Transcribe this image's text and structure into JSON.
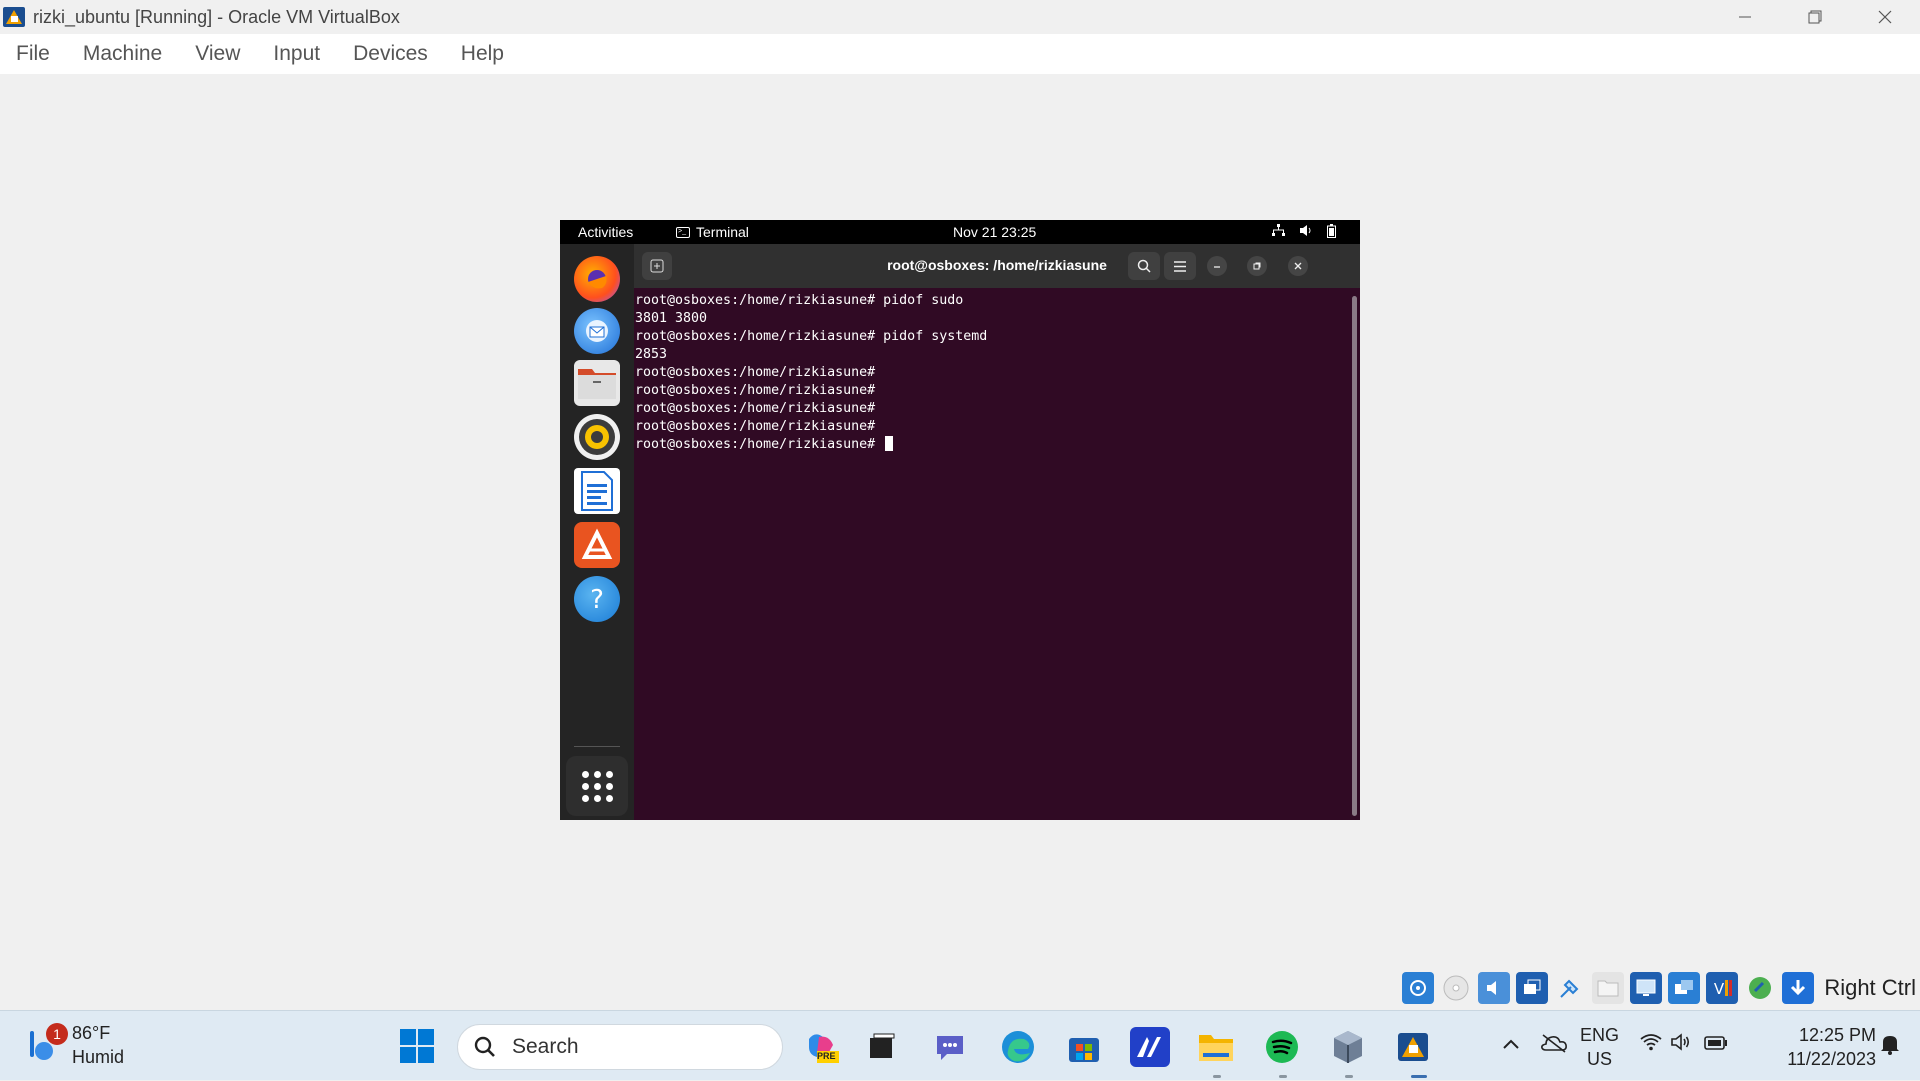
{
  "window": {
    "title": "rizki_ubuntu [Running] - Oracle VM VirtualBox",
    "controls": [
      "minimize",
      "restore",
      "close"
    ]
  },
  "menubar": {
    "items": [
      "File",
      "Machine",
      "View",
      "Input",
      "Devices",
      "Help"
    ]
  },
  "guest": {
    "topbar": {
      "activities": "Activities",
      "app_name": "Terminal",
      "clock": "Nov 21  23:25"
    },
    "dock": {
      "apps": [
        "firefox-icon",
        "thunderbird-icon",
        "files-icon",
        "rhythmbox-icon",
        "writer-icon",
        "app-center-icon",
        "help-icon"
      ]
    },
    "terminal": {
      "title": "root@osboxes: /home/rizkiasune",
      "lines": [
        "root@osboxes:/home/rizkiasune# pidof sudo",
        "3801 3800",
        "root@osboxes:/home/rizkiasune# pidof systemd",
        "2853",
        "root@osboxes:/home/rizkiasune#",
        "root@osboxes:/home/rizkiasune#",
        "root@osboxes:/home/rizkiasune#",
        "root@osboxes:/home/rizkiasune#"
      ],
      "prompt": "root@osboxes:/home/rizkiasune# "
    }
  },
  "vbox_status": {
    "host_key": "Right Ctrl"
  },
  "taskbar": {
    "weather": {
      "badge": "1",
      "temp": "86°F",
      "condition": "Humid"
    },
    "search_label": "Search",
    "copilot_badge": "PRE",
    "lang_line1": "ENG",
    "lang_line2": "US",
    "time": "12:25 PM",
    "date": "11/22/2023"
  },
  "colors": {
    "terminal_bg": "#300a24",
    "windows_accent": "#0078d4"
  }
}
